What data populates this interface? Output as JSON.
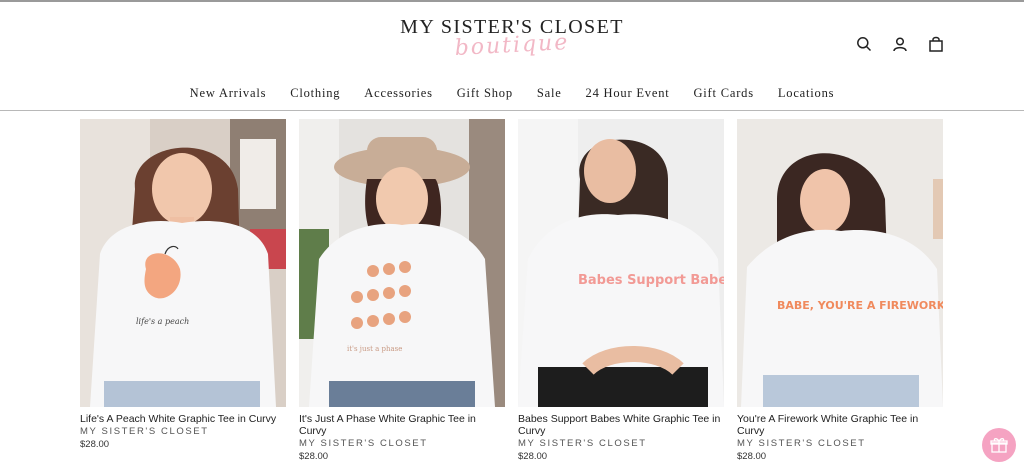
{
  "brand": {
    "name": "MY SISTER'S CLOSET",
    "script": "boutique"
  },
  "header_icons": [
    "search-icon",
    "account-icon",
    "cart-icon"
  ],
  "nav": [
    "New Arrivals",
    "Clothing",
    "Accessories",
    "Gift Shop",
    "Sale",
    "24 Hour Event",
    "Gift Cards",
    "Locations"
  ],
  "products": [
    {
      "name": "Life's A Peach White Graphic Tee in Curvy",
      "brand": "MY SISTER'S CLOSET",
      "price": "$28.00",
      "graphic_text": "life's a peach"
    },
    {
      "name": "It's Just A Phase White Graphic Tee in Curvy",
      "brand": "MY SISTER'S CLOSET",
      "price": "$28.00",
      "graphic_text": "it's just a phase"
    },
    {
      "name": "Babes Support Babes White Graphic Tee in Curvy",
      "brand": "MY SISTER'S CLOSET",
      "price": "$28.00",
      "graphic_text": "Babes Support Babes"
    },
    {
      "name": "You're A Firework White Graphic Tee in Curvy",
      "brand": "MY SISTER'S CLOSET",
      "price": "$28.00",
      "graphic_text": "BABE, YOU'RE A FIREWORK"
    }
  ],
  "colors": {
    "accent_pink": "#f5a3c2",
    "script_pink": "#f2b8c6",
    "rule": "#b8b8b8"
  },
  "floating_button": "gift-icon"
}
